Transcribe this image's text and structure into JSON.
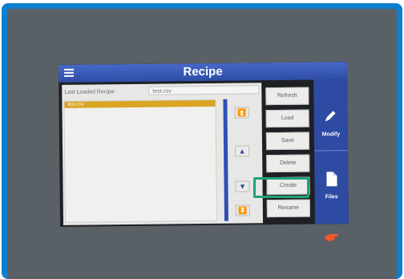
{
  "header": {
    "title": "Recipe"
  },
  "last_loaded": {
    "label": "Last Loaded Recipe",
    "value": "test.csv"
  },
  "recipe_list": {
    "items": [
      "test.csv"
    ]
  },
  "actions": [
    "Refresh",
    "Load",
    "Save",
    "Delete",
    "Create",
    "Rename"
  ],
  "side_panel": {
    "modify_label": "Modify",
    "files_label": "Files"
  },
  "icons": [
    "menu-icon",
    "page-top-icon",
    "page-up-icon",
    "page-down-icon",
    "page-bottom-icon",
    "pencil-icon",
    "file-icon",
    "hand-pointer-icon"
  ],
  "colors": {
    "title_bar": "#3a5bbd",
    "highlight": "#1fa37a",
    "selected_item": "#d9a523"
  }
}
